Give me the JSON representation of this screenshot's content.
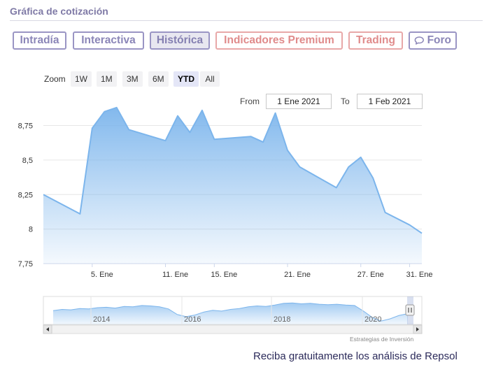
{
  "header": {
    "title": "Gráfica de cotización"
  },
  "tabs": [
    {
      "label": "Intradía",
      "kind": "normal"
    },
    {
      "label": "Interactiva",
      "kind": "normal"
    },
    {
      "label": "Histórica",
      "kind": "active"
    },
    {
      "label": "Indicadores Premium",
      "kind": "premium"
    },
    {
      "label": "Trading",
      "kind": "premium"
    },
    {
      "label": "Foro",
      "kind": "normal",
      "icon": "speech-bubble-icon"
    }
  ],
  "zoom": {
    "label": "Zoom",
    "buttons": [
      "1W",
      "1M",
      "3M",
      "6M",
      "YTD",
      "All"
    ],
    "selected": "YTD"
  },
  "range": {
    "from_label": "From",
    "from_value": "1 Ene 2021",
    "to_label": "To",
    "to_value": "1 Feb 2021"
  },
  "colors": {
    "line": "#7cb5ec",
    "tab_border": "#9a95c4",
    "premium_border": "#e8a8a8"
  },
  "chart_data": {
    "type": "area",
    "title": "",
    "xlabel": "",
    "ylabel": "",
    "ylim": [
      7.75,
      8.95
    ],
    "y_ticks": [
      "7,75",
      "8",
      "8,25",
      "8,5",
      "8,75"
    ],
    "x_ticks": [
      "5. Ene",
      "11. Ene",
      "15. Ene",
      "21. Ene",
      "27. Ene",
      "31. Ene"
    ],
    "series": [
      {
        "name": "",
        "dates": [
          "2021-01-01",
          "2021-01-04",
          "2021-01-05",
          "2021-01-06",
          "2021-01-07",
          "2021-01-08",
          "2021-01-11",
          "2021-01-12",
          "2021-01-13",
          "2021-01-14",
          "2021-01-15",
          "2021-01-18",
          "2021-01-19",
          "2021-01-20",
          "2021-01-21",
          "2021-01-22",
          "2021-01-25",
          "2021-01-26",
          "2021-01-27",
          "2021-01-28",
          "2021-01-29",
          "2021-01-31",
          "2021-02-01"
        ],
        "values": [
          8.25,
          8.11,
          8.73,
          8.85,
          8.88,
          8.72,
          8.64,
          8.82,
          8.7,
          8.86,
          8.65,
          8.67,
          8.63,
          8.84,
          8.57,
          8.45,
          8.3,
          8.45,
          8.52,
          8.37,
          8.12,
          8.03,
          7.97
        ]
      }
    ],
    "grid": true,
    "legend": "none"
  },
  "navigator": {
    "year_labels": [
      "2014",
      "2016",
      "2018",
      "2020"
    ],
    "values": [
      7.2,
      7.5,
      7.4,
      7.7,
      7.6,
      7.9,
      8.0,
      7.8,
      8.2,
      8.1,
      8.4,
      8.3,
      8.1,
      7.6,
      6.3,
      5.8,
      6.2,
      6.9,
      7.3,
      7.1,
      7.5,
      7.7,
      8.1,
      8.3,
      8.2,
      8.5,
      8.9,
      9.0,
      8.8,
      8.9,
      8.7,
      8.6,
      8.7,
      8.5,
      8.4,
      7.1,
      5.6,
      4.8,
      5.3,
      6.1,
      6.5
    ]
  },
  "credit": "Estrategias de Inversión",
  "footer": {
    "note": "Reciba gratuitamente los análisis de Repsol"
  }
}
